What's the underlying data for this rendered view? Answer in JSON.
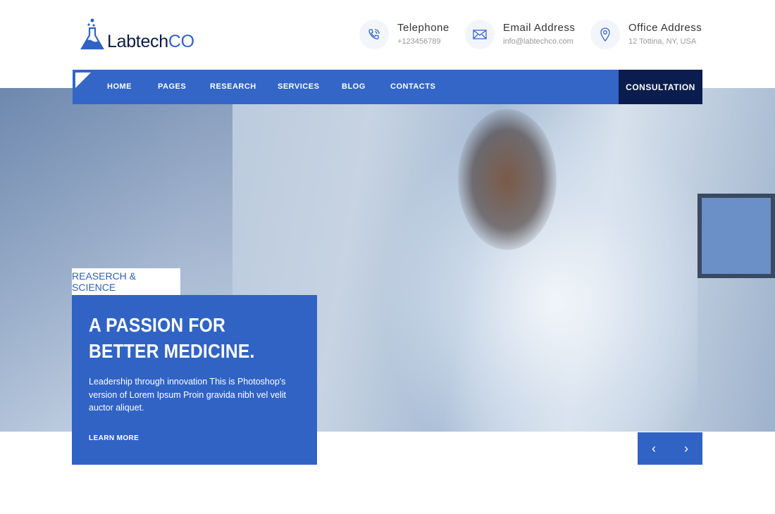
{
  "brand": {
    "name_part1": "Labtech",
    "name_part2": "CO"
  },
  "contacts": [
    {
      "icon": "phone-icon",
      "title": "Telephone",
      "value": "+123456789"
    },
    {
      "icon": "email-icon",
      "title": "Email Address",
      "value": "info@labtechco.com"
    },
    {
      "icon": "location-pin-icon",
      "title": "Office Address",
      "value": "12 Tottina, NY, USA"
    }
  ],
  "nav": {
    "items": [
      "HOME",
      "PAGES",
      "RESEARCH",
      "SERVICES",
      "BLOG",
      "CONTACTS"
    ],
    "cta": "CONSULTATION"
  },
  "hero": {
    "tag": "REASERCH & SCIENCE",
    "title": "A PASSION FOR BETTER MEDICINE.",
    "description": "Leadership through innovation This is Photoshop's version of Lorem Ipsum Proin gravida nibh vel velit auctor aliquet.",
    "link": "LEARN MORE",
    "prev": "‹",
    "next": "›"
  },
  "colors": {
    "primary": "#3063c4",
    "dark": "#0b1d4f"
  }
}
